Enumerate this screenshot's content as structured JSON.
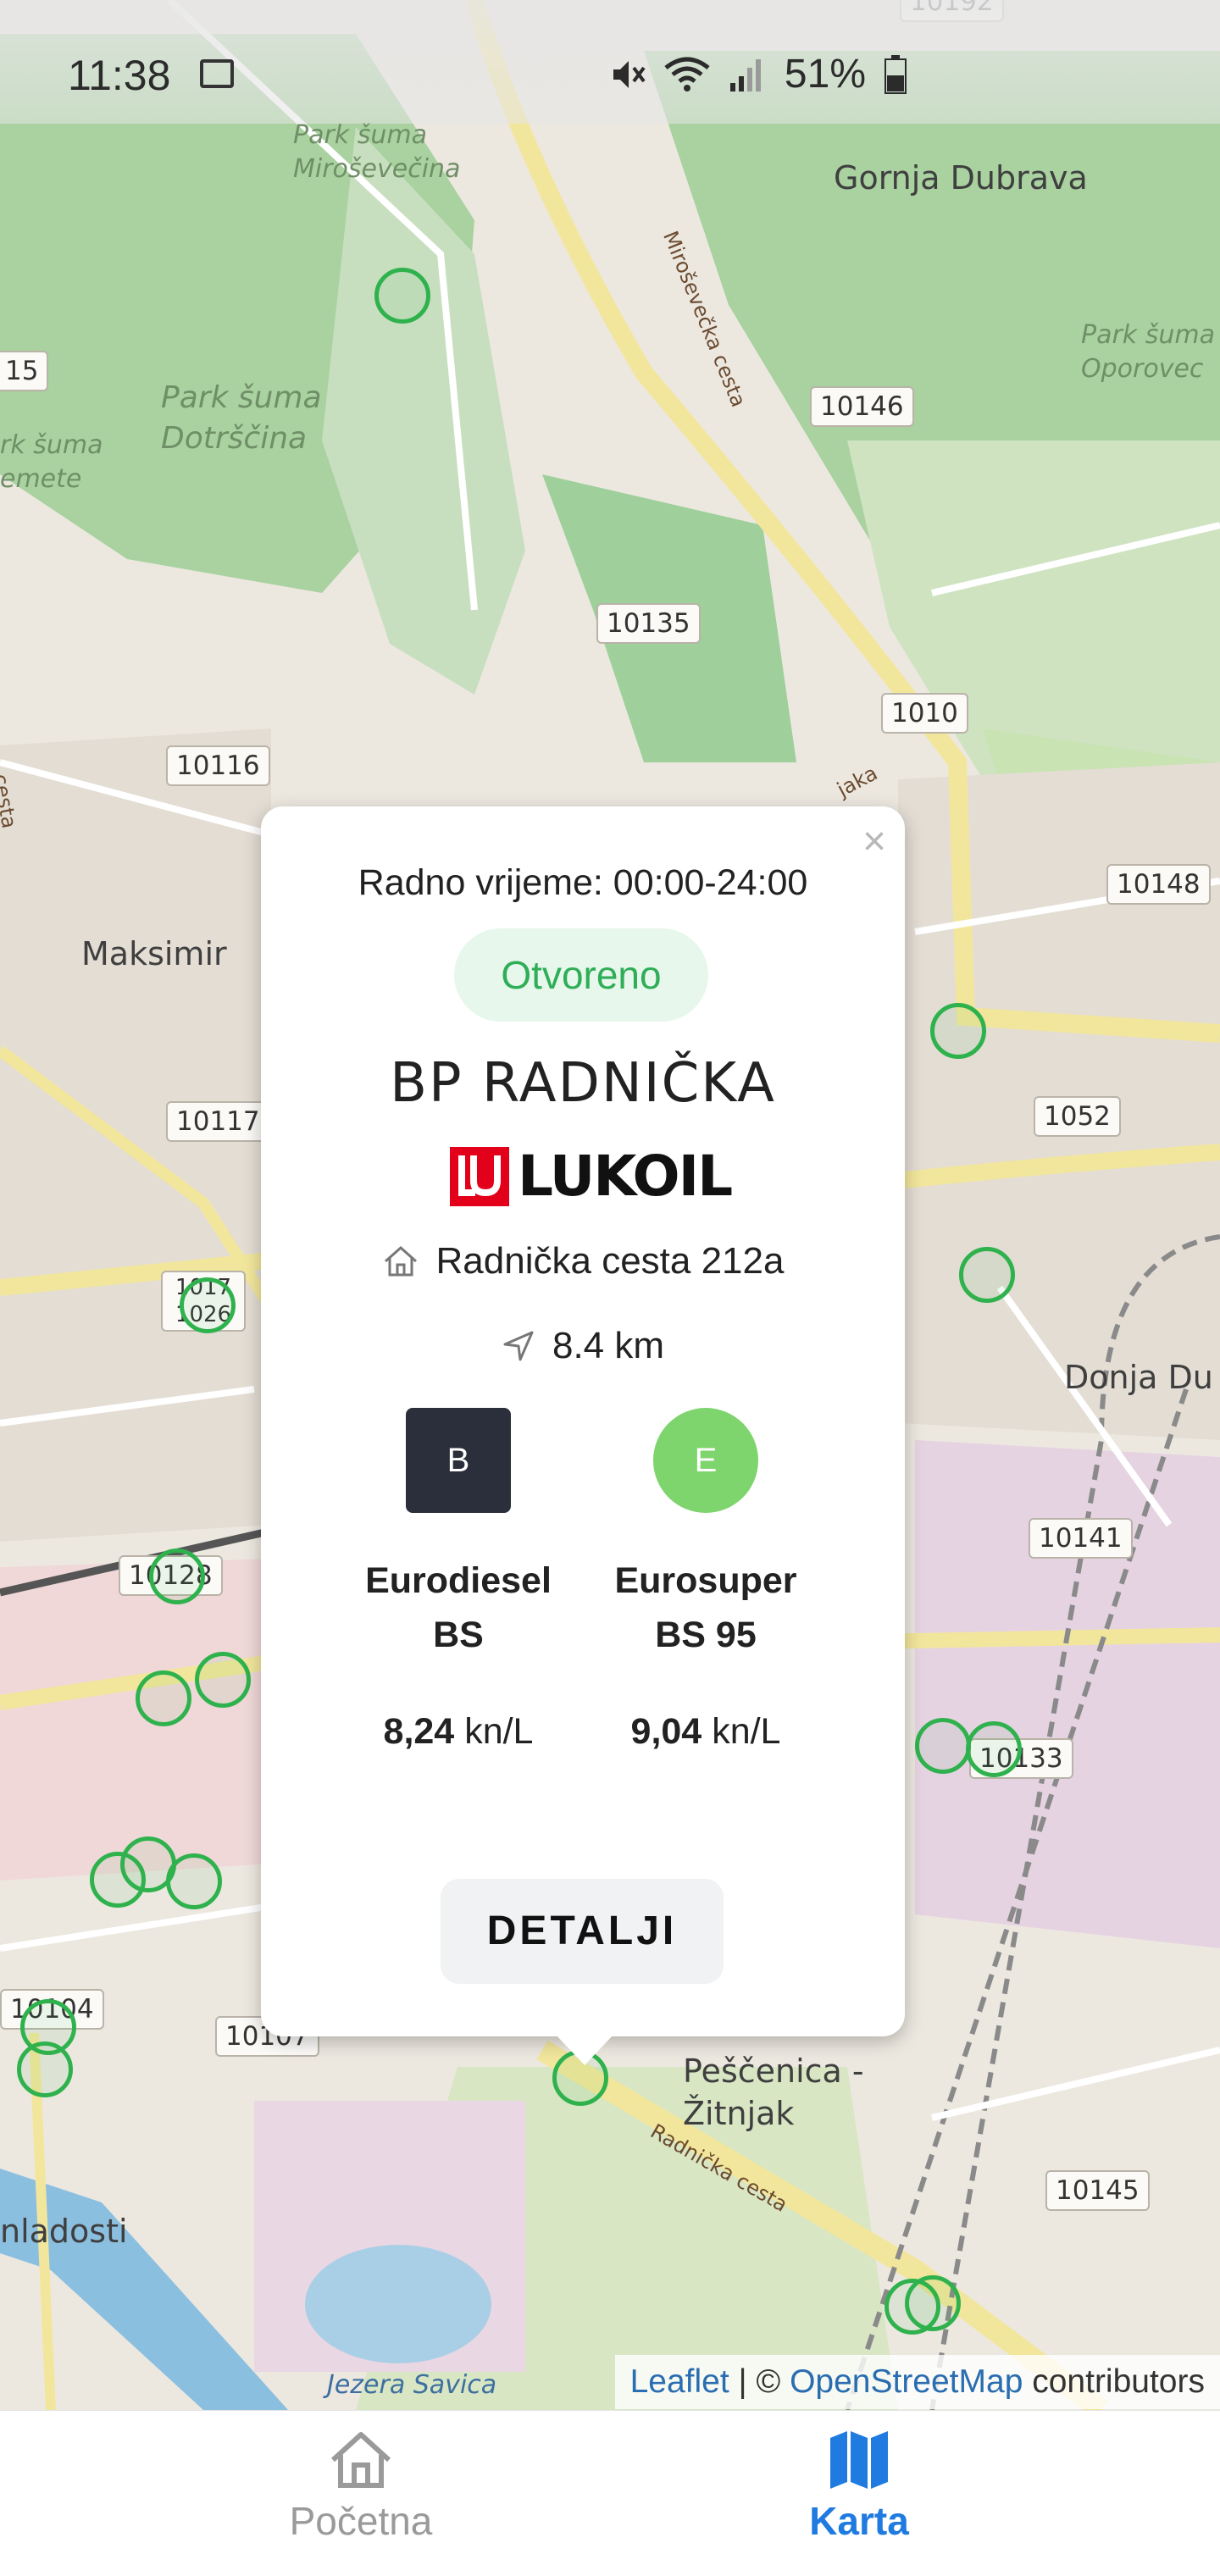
{
  "status_bar": {
    "time": "11:38",
    "battery_percent": "51%"
  },
  "map": {
    "places": {
      "park_mirosevecina": "Park šuma\nMiroševečina",
      "gornja_dubrava": "Gornja Dubrava",
      "park_oporovec": "Park šuma\nOporovec",
      "park_dotrscina": "Park šuma\nDotrščina",
      "park_remete": "rk šuma\nemete",
      "maksimir": "Maksimir",
      "donja_dubrava": "Donja Du",
      "pescenica": "Peščenica -\nŽitnjak",
      "mladosti": "nladosti",
      "jezera_savica": "Jezera Savica"
    },
    "roads": {
      "mirosevecka": "Miroševečka cesta",
      "radnicka": "Radnička cesta",
      "cesta_left": "cesta",
      "jaka": "jaka"
    },
    "shields": [
      "15",
      "10146",
      "10135",
      "1010",
      "10116",
      "10148",
      "1052",
      "10117",
      "1017 1026",
      "10141",
      "10128",
      "10133",
      "10104",
      "10107",
      "10145",
      "10192"
    ]
  },
  "popup": {
    "close_label": "×",
    "hours": "Radno vrijeme: 00:00-24:00",
    "status": "Otvoreno",
    "station_name": "BP RADNIČKA",
    "brand": "LUKOIL",
    "address": "Radnička cesta 212a",
    "distance": "8.4 km",
    "fuels": [
      {
        "badge": "B",
        "name_line1": "Eurodiesel",
        "name_line2": "BS",
        "price": "8,24",
        "unit": "kn/L"
      },
      {
        "badge": "E",
        "name_line1": "Eurosuper",
        "name_line2": "BS 95",
        "price": "9,04",
        "unit": "kn/L"
      }
    ],
    "details_button": "DETALJI"
  },
  "attribution": {
    "leaflet": "Leaflet",
    "sep": " | © ",
    "osm": "OpenStreetMap",
    "suffix": " contributors"
  },
  "nav": {
    "home": "Početna",
    "map": "Karta"
  },
  "colors": {
    "accent": "#1f7be0",
    "marker": "#2fb24d",
    "open_green": "#2fae57",
    "lukoil_red": "#e2001a"
  }
}
